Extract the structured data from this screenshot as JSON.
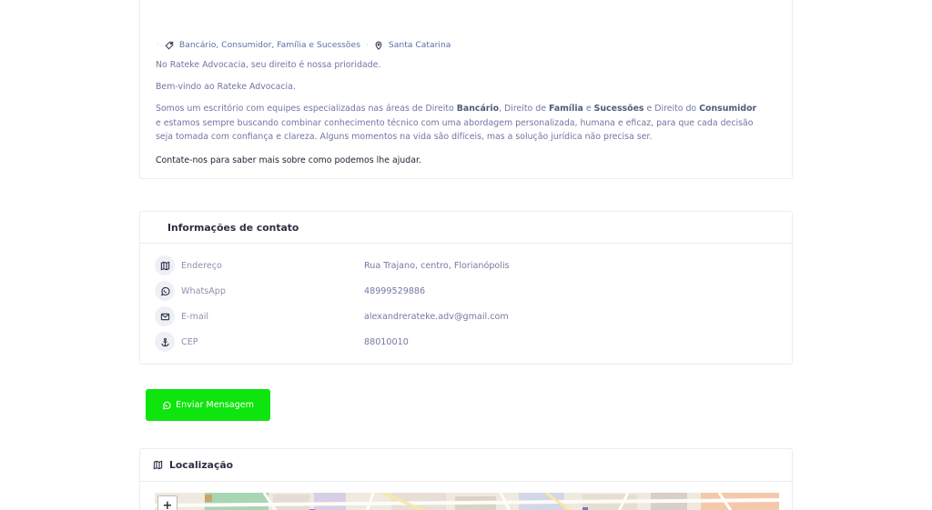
{
  "about": {
    "tags": "Bancário, Consumidor, Família e Sucessões",
    "location": "Santa Catarina",
    "p1": "No Rateke Advocacia, seu direito é nossa prioridade.",
    "p2": "Bem-vindo ao Rateke Advocacia.",
    "p3_a": "Somos um escritório com equipes especializadas nas áreas de Direito ",
    "p3_b1": "Bancário",
    "p3_c": ", Direito de ",
    "p3_b2": "Família",
    "p3_d": " e ",
    "p3_b3": "Sucessões",
    "p3_e": " e Direito do ",
    "p3_b4": "Consumidor",
    "p3_f": " e estamos sempre buscando combinar conhecimento técnico com uma abordagem personalizada, humana e eficaz, para que cada decisão seja tomada com confiança e clareza. Alguns momentos na vida são difíceis, mas a solução jurídica não precisa ser.",
    "p4": "Contate-nos para saber mais sobre como podemos lhe ajudar."
  },
  "contact": {
    "title": "Informações de contato",
    "rows": [
      {
        "label": "Endereço",
        "value": "Rua Trajano, centro, Florianópolis",
        "icon": "map-icon"
      },
      {
        "label": "WhatsApp",
        "value": "48999529886",
        "icon": "whatsapp-icon"
      },
      {
        "label": "E-mail",
        "value": "alexandrerateke.adv@gmail.com",
        "icon": "mail-icon"
      },
      {
        "label": "CEP",
        "value": "88010010",
        "icon": "anchor-icon"
      }
    ]
  },
  "button": {
    "label": "Enviar Mensagem",
    "color": "#0ee40d"
  },
  "location": {
    "title": "Localização",
    "zoom_in": "+"
  }
}
